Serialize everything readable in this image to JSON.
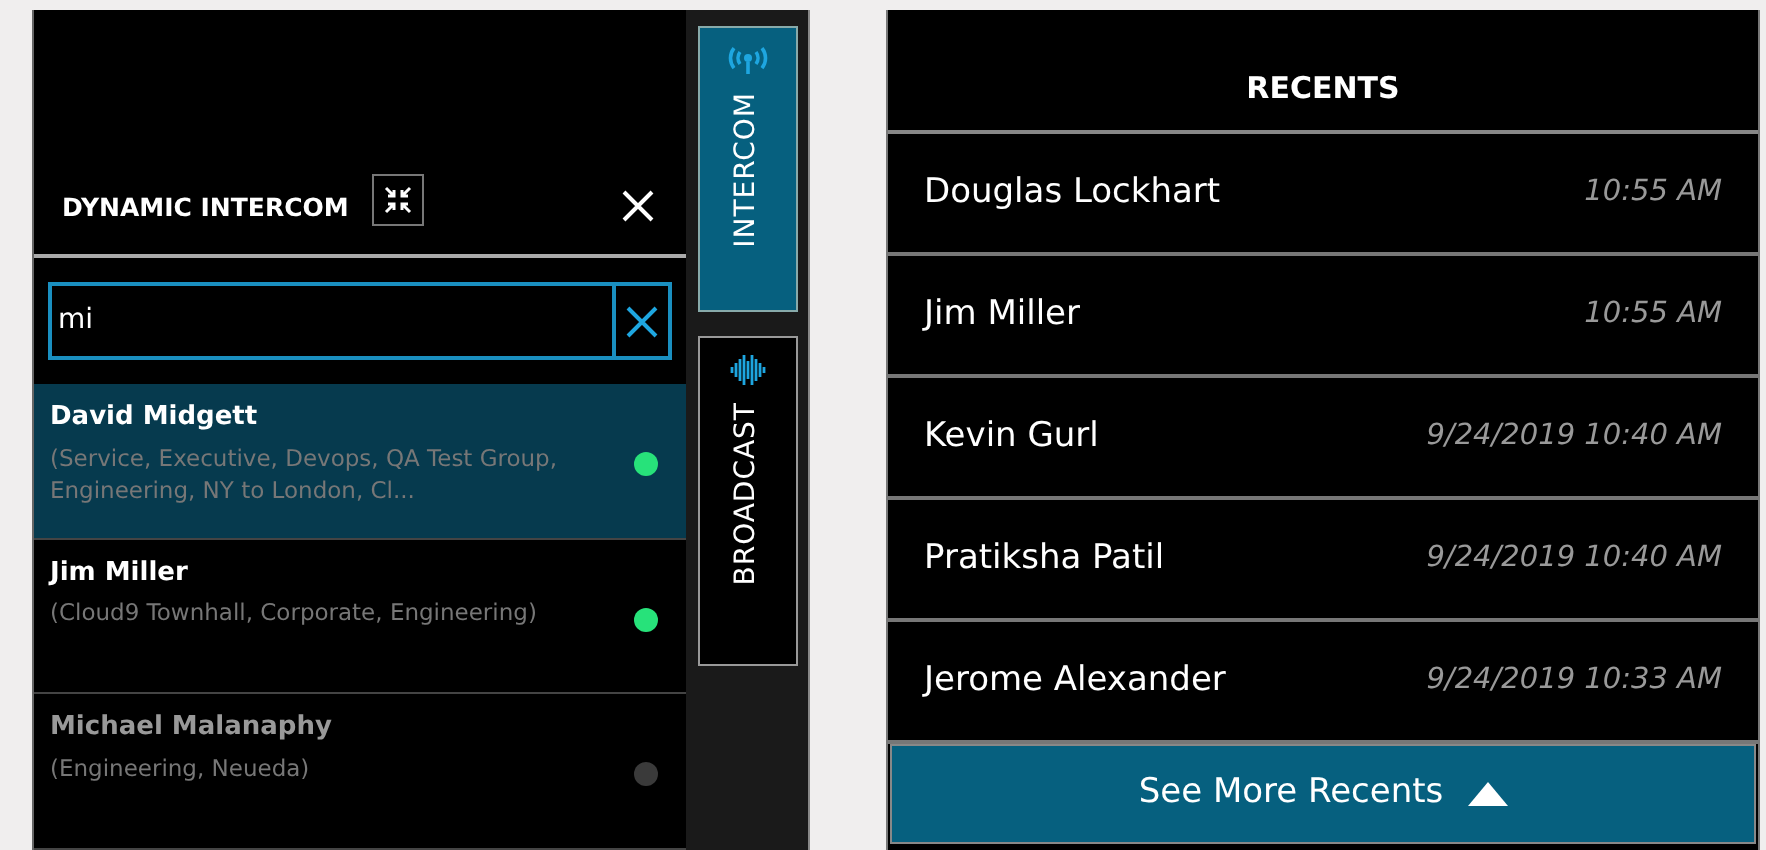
{
  "intercom": {
    "title": "DYNAMIC INTERCOM",
    "search": {
      "value": "mi"
    },
    "contacts": [
      {
        "name": "David Midgett",
        "groups": "(Service, Executive, Devops, QA Test Group, Engineering, NY to London, Cl...",
        "online": true,
        "selected": true
      },
      {
        "name": "Jim Miller",
        "groups": "(Cloud9 Townhall, Corporate, Engineering)",
        "online": true,
        "selected": false
      },
      {
        "name": "Michael Malanaphy",
        "groups": "(Engineering, Neueda)",
        "online": false,
        "selected": false
      }
    ]
  },
  "side_tabs": [
    {
      "label": "INTERCOM",
      "kind": "intercom",
      "selected": true
    },
    {
      "label": "BROADCAST",
      "kind": "broadcast",
      "selected": false
    }
  ],
  "recents": {
    "title": "RECENTS",
    "rows": [
      {
        "name": "Douglas Lockhart",
        "time": "10:55 AM"
      },
      {
        "name": "Jim Miller",
        "time": "10:55 AM"
      },
      {
        "name": "Kevin Gurl",
        "time": "9/24/2019 10:40 AM"
      },
      {
        "name": "Pratiksha Patil",
        "time": "9/24/2019 10:40 AM"
      },
      {
        "name": "Jerome Alexander",
        "time": "9/24/2019 10:33 AM"
      }
    ],
    "button": "See More Recents"
  }
}
